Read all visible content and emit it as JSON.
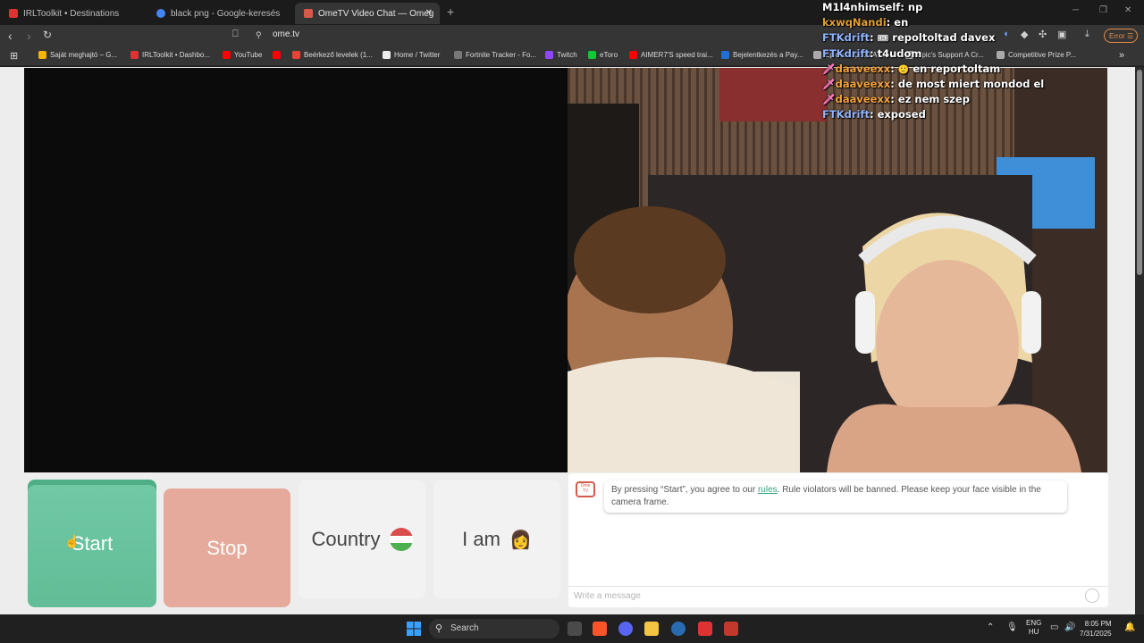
{
  "browser": {
    "tabs": [
      {
        "title": "IRLToolkit • Destinations",
        "color": "#d33"
      },
      {
        "title": "black png - Google-keresés",
        "color": "#4285f4"
      },
      {
        "title": "OmeTV Video Chat — Omeg",
        "color": "#d65a4a"
      }
    ],
    "url": "ome.tv",
    "error_badge": "Error",
    "bookmarks": [
      {
        "label": "Saját meghajtó – G...",
        "color": "#f4b400"
      },
      {
        "label": "IRLToolkit • Dashbo...",
        "color": "#d33"
      },
      {
        "label": "YouTube",
        "color": "#f00"
      },
      {
        "label": "",
        "color": "#f00"
      },
      {
        "label": "Beérkező levelek (1...",
        "color": "#ea4335"
      },
      {
        "label": "Home / Twitter",
        "color": "#fff"
      },
      {
        "label": "Fortnite Tracker - Fo...",
        "color": "#777"
      },
      {
        "label": "Twitch",
        "color": "#9146ff"
      },
      {
        "label": "eToro",
        "color": "#13c636"
      },
      {
        "label": "AIMER7'S speed trai...",
        "color": "#f00"
      },
      {
        "label": "Bejelentkezés a Pay...",
        "color": "#1e6fd6"
      },
      {
        "label": "Epic's Support A Cr...",
        "color": "#aaa"
      },
      {
        "label": "Epic's Support A Cr...",
        "color": "#aaa"
      },
      {
        "label": "Competitive Prize P...",
        "color": "#aaa"
      }
    ]
  },
  "page": {
    "start_label": "Start",
    "stop_label": "Stop",
    "country_label": "Country",
    "iam_label": "I am",
    "rules_text_1": "By pressing “Start”, you agree to our ",
    "rules_link": "rules",
    "rules_text_2": ". Rule violators will be banned. Please keep your face visible in the camera frame.",
    "message_placeholder": "Write a message",
    "logo_text": "Ome TV"
  },
  "chat_overlay": [
    {
      "user": "M1l4nhimself",
      "color": "#ffffff",
      "text": "np"
    },
    {
      "user": "kxwqNandi",
      "color": "#e0a030",
      "text": "en"
    },
    {
      "user": "FTKdrift",
      "color": "#8fb3ff",
      "text": "repoltoltad davex"
    },
    {
      "user": "FTKdrift",
      "color": "#8fb3ff",
      "text": "t4udom"
    },
    {
      "user": "daaveexx",
      "color": "#f3a33c",
      "text": "en reportoltam"
    },
    {
      "user": "daaveexx",
      "color": "#f3a33c",
      "text": "de most miert mondod el"
    },
    {
      "user": "daaveexx",
      "color": "#f3a33c",
      "text": "ez nem szep"
    },
    {
      "user": "FTKdrift",
      "color": "#8fb3ff",
      "text": "exposed"
    }
  ],
  "taskbar": {
    "search_label": "Search",
    "lang_1": "ENG",
    "lang_2": "HU",
    "time": "8:05 PM",
    "date": "7/31/2025"
  }
}
